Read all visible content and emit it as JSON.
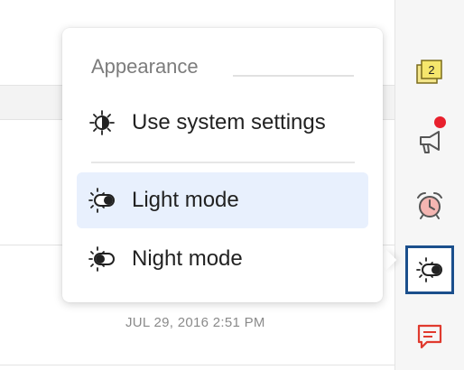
{
  "background": {
    "timestamp": "JUL 29, 2016 2:51 PM"
  },
  "toolbar": {
    "items": [
      {
        "name": "notes-icon",
        "badge": "2"
      },
      {
        "name": "megaphone-icon"
      },
      {
        "name": "alarm-clock-icon"
      },
      {
        "name": "appearance-toggle-icon"
      },
      {
        "name": "chat-icon"
      }
    ]
  },
  "appearance_menu": {
    "title": "Appearance",
    "items": [
      {
        "label": "Use system settings",
        "icon": "system-settings-icon"
      },
      {
        "label": "Light mode",
        "icon": "light-mode-icon",
        "selected": true
      },
      {
        "label": "Night mode",
        "icon": "night-mode-icon"
      }
    ]
  },
  "colors": {
    "selected_bg": "#e8f0fd",
    "active_border": "#1b4f8c",
    "notification_dot": "#e8202d"
  }
}
